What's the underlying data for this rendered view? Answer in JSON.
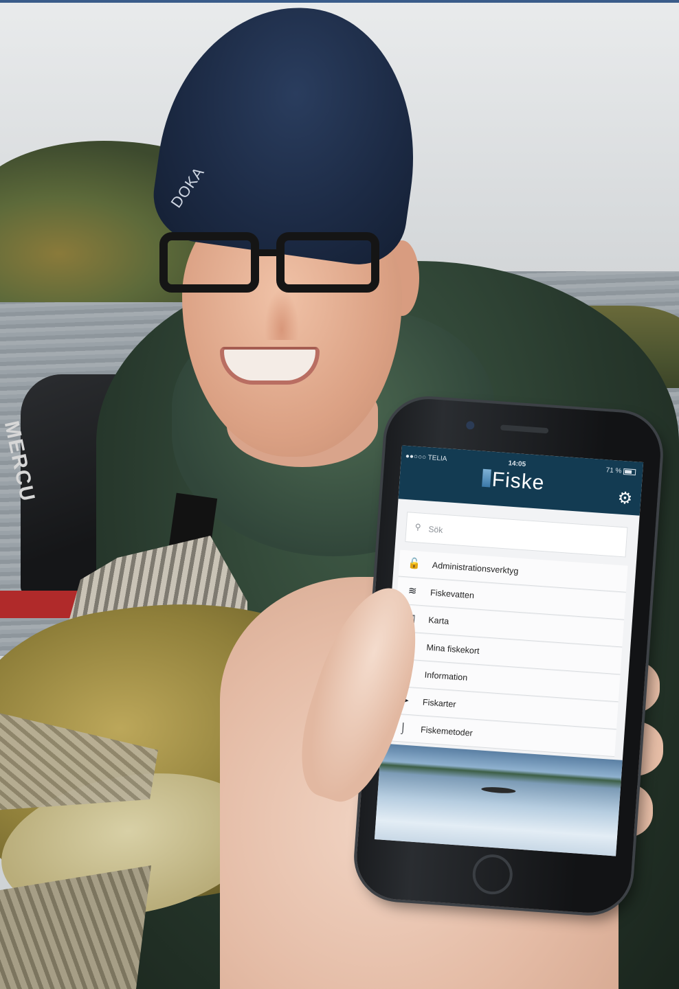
{
  "status_bar": {
    "carrier": "●●○○○ TELIA",
    "time": "14:05",
    "battery": "71 %"
  },
  "app": {
    "brand_name": "Fiske",
    "settings_icon": "gear-icon"
  },
  "search": {
    "placeholder": "Sök",
    "icon": "search-icon"
  },
  "menu": {
    "items": [
      {
        "label": "Administrationsverktyg",
        "icon": "unlock-icon",
        "glyph": "🔓"
      },
      {
        "label": "Fiskevatten",
        "icon": "water-icon",
        "glyph": "≋"
      },
      {
        "label": "Karta",
        "icon": "map-icon",
        "glyph": "▥"
      },
      {
        "label": "Mina fiskekort",
        "icon": "card-icon",
        "glyph": "▤"
      },
      {
        "label": "Information",
        "icon": "info-icon",
        "glyph": "ℹ"
      },
      {
        "label": "Fiskarter",
        "icon": "fish-icon",
        "glyph": "➤"
      },
      {
        "label": "Fiskemetoder",
        "icon": "hook-icon",
        "glyph": "⌡"
      }
    ]
  },
  "photo": {
    "motor_brand": "MERCU",
    "hat_logo": "DOKA"
  },
  "colors": {
    "app_header": "#133b52",
    "screen_background": "#f2f3f5"
  }
}
